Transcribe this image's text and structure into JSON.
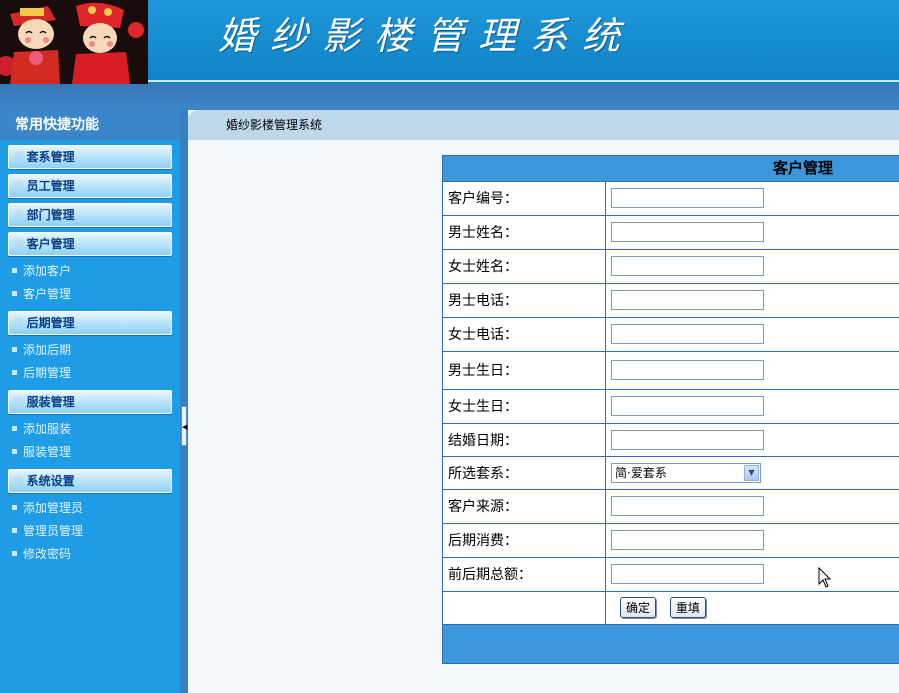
{
  "header": {
    "app_title": "婚纱影楼管理系统",
    "logo_icon": "wedding-couple-logo"
  },
  "sidebar": {
    "title": "常用快捷功能",
    "groups": [
      {
        "label": "套系管理",
        "items": []
      },
      {
        "label": "员工管理",
        "items": []
      },
      {
        "label": "部门管理",
        "items": []
      },
      {
        "label": "客户管理",
        "items": [
          "添加客户",
          "客户管理"
        ]
      },
      {
        "label": "后期管理",
        "items": [
          "添加后期",
          "后期管理"
        ]
      },
      {
        "label": "服装管理",
        "items": [
          "添加服装",
          "服装管理"
        ]
      },
      {
        "label": "系统设置",
        "items": [
          "添加管理员",
          "管理员管理",
          "修改密码"
        ]
      }
    ]
  },
  "breadcrumb": "婚纱影楼管理系统",
  "form": {
    "title": "客户管理",
    "fields": [
      {
        "label": "客户编号：",
        "value": ""
      },
      {
        "label": "男士姓名：",
        "value": ""
      },
      {
        "label": "女士姓名：",
        "value": ""
      },
      {
        "label": "男士电话：",
        "value": ""
      },
      {
        "label": "女士电话：",
        "value": ""
      },
      {
        "label": "男士生日：",
        "value": ""
      },
      {
        "label": "女士生日：",
        "value": ""
      },
      {
        "label": "结婚日期：",
        "value": ""
      },
      {
        "label": "所选套系：",
        "selected": "简·爱套系"
      },
      {
        "label": "客户来源：",
        "value": ""
      },
      {
        "label": "后期消费：",
        "value": ""
      },
      {
        "label": "前后期总额：",
        "value": ""
      }
    ],
    "buttons": {
      "confirm": "确定",
      "reset": "重填"
    }
  },
  "colors": {
    "header_blue": "#1e97d8",
    "sidebar_blue": "#1e9ce5",
    "table_header_blue": "#3b96dc",
    "border_blue": "#2f6db5"
  }
}
